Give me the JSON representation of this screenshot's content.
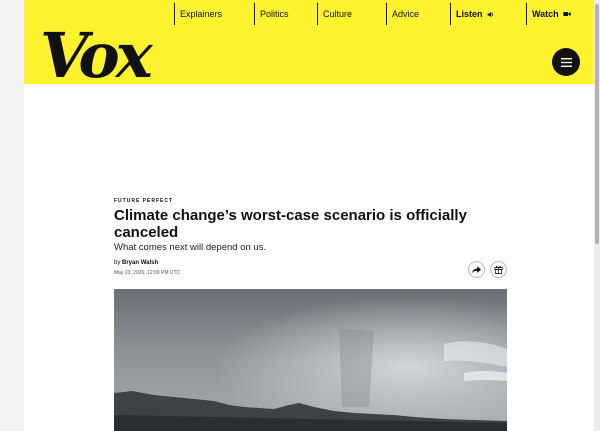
{
  "site": {
    "logo_text": "Vox"
  },
  "nav": {
    "items": [
      {
        "label": "Explainers"
      },
      {
        "label": "Politics"
      },
      {
        "label": "Culture"
      },
      {
        "label": "Advice"
      },
      {
        "label": "Listen",
        "icon": "speaker-icon"
      },
      {
        "label": "Watch",
        "icon": "video-camera-icon"
      }
    ],
    "menu_icon": "hamburger-menu-icon"
  },
  "article": {
    "kicker": "FUTURE PERFECT",
    "headline": "Climate change’s worst-case scenario is officially canceled",
    "dek": "What comes next will depend on us.",
    "byline_prefix": "by",
    "author": "Bryan Walsh",
    "date": "May 23, 2026, 12:00 PM UTC",
    "share_icon": "share-arrow-icon",
    "gift_icon": "gift-icon"
  },
  "colors": {
    "header_bg": "#fff22e",
    "text": "#111111",
    "page_bg": "#ffffff"
  }
}
